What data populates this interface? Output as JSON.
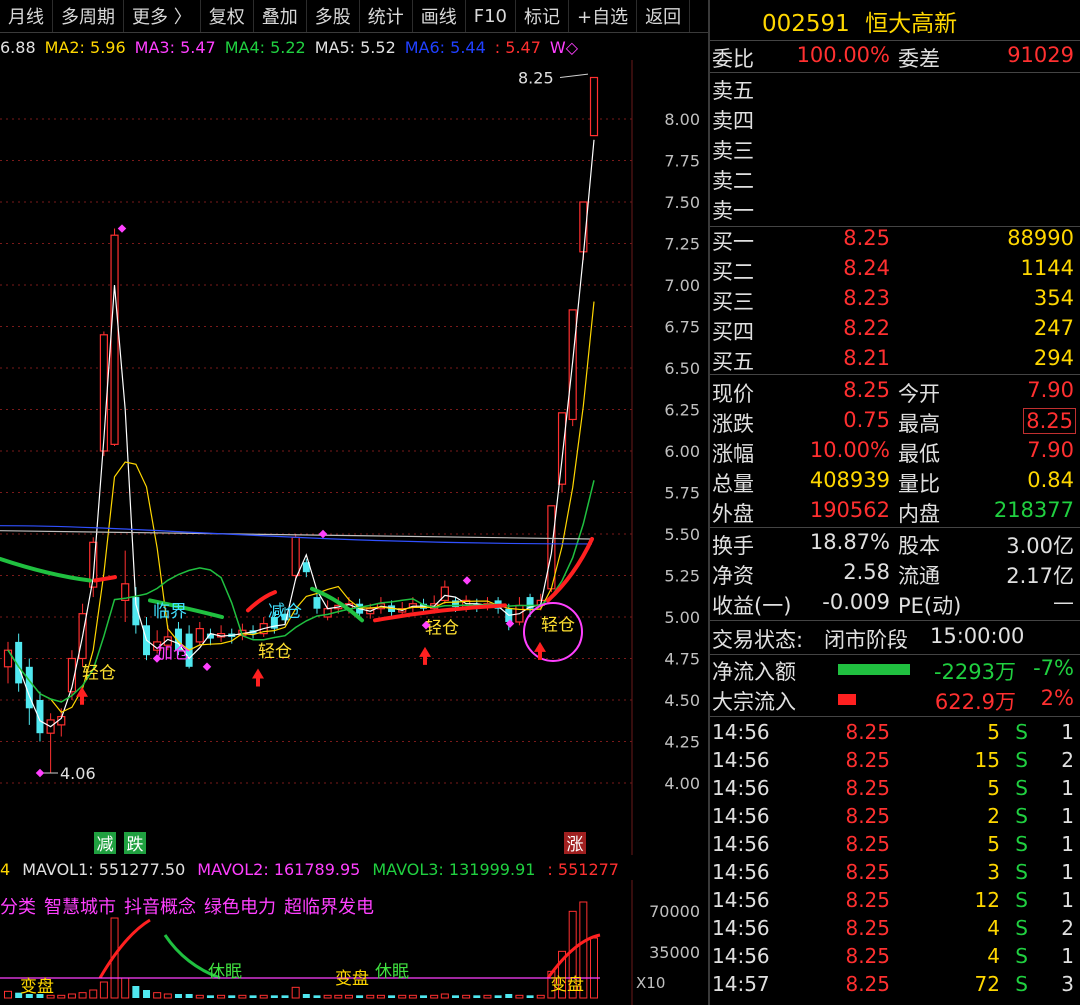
{
  "toolbar": {
    "items": [
      "月线",
      "多周期",
      "更多 〉",
      "复权",
      "叠加",
      "多股",
      "统计",
      "画线",
      "F10",
      "标记",
      "+自选",
      "返回"
    ]
  },
  "ma_legend": {
    "ma1": "6.88",
    "ma2_label": "MA2: 5.96",
    "ma3_label": "MA3: 5.47",
    "ma4_label": "MA4: 5.22",
    "ma5_label": "MA5: 5.52",
    "ma6_label": "MA6: 5.44",
    "ma7_label": ": 5.47",
    "extra": "W◇"
  },
  "price_axis": [
    "8.00",
    "7.75",
    "7.50",
    "7.25",
    "7.00",
    "6.75",
    "6.50",
    "6.25",
    "6.00",
    "5.75",
    "5.50",
    "5.25",
    "5.00",
    "4.75",
    "4.50",
    "4.25",
    "4.00"
  ],
  "annotations": {
    "high_label": "8.25",
    "low_label": "4.06",
    "signal_light": "轻仓",
    "signal_add": "加仓",
    "signal_linjie": "临界",
    "signal_jian": "减仓",
    "signal_reduce": "减",
    "signal_fall": "跌",
    "signal_rise": "涨"
  },
  "vol_legend": {
    "v0": "4",
    "mavol1": "MAVOL1: 551277.50",
    "mavol2": "MAVOL2: 161789.95",
    "mavol3": "MAVOL3: 131999.91",
    "mavol4": ": 551277"
  },
  "concepts": [
    "分类",
    "智慧城市",
    "抖音概念",
    "绿色电力",
    "超临界发电"
  ],
  "vol_axis": [
    "70000",
    "35000"
  ],
  "vol_scale": "X10",
  "vol_marks": {
    "sleep": "休眠",
    "change": "变盘"
  },
  "stock": {
    "code": "002591",
    "name": "恒大高新"
  },
  "weibi": {
    "label1": "委比",
    "value1": "100.00%",
    "label2": "委差",
    "value2": "91029"
  },
  "sell": [
    {
      "label": "卖五"
    },
    {
      "label": "卖四"
    },
    {
      "label": "卖三"
    },
    {
      "label": "卖二"
    },
    {
      "label": "卖一"
    }
  ],
  "buy": [
    {
      "label": "买一",
      "price": "8.25",
      "vol": "88990"
    },
    {
      "label": "买二",
      "price": "8.24",
      "vol": "1144"
    },
    {
      "label": "买三",
      "price": "8.23",
      "vol": "354"
    },
    {
      "label": "买四",
      "price": "8.22",
      "vol": "247"
    },
    {
      "label": "买五",
      "price": "8.21",
      "vol": "294"
    }
  ],
  "quote": [
    {
      "l1": "现价",
      "v1": "8.25",
      "l2": "今开",
      "v2": "7.90"
    },
    {
      "l1": "涨跌",
      "v1": "0.75",
      "l2": "最高",
      "v2": "8.25"
    },
    {
      "l1": "涨幅",
      "v1": "10.00%",
      "l2": "最低",
      "v2": "7.90"
    },
    {
      "l1": "总量",
      "v1": "408939",
      "l2": "量比",
      "v2": "0.84"
    },
    {
      "l1": "外盘",
      "v1": "190562",
      "l2": "内盘",
      "v2": "218377"
    }
  ],
  "fund": [
    {
      "l1": "换手",
      "v1": "18.87%",
      "l2": "股本",
      "v2": "3.00亿"
    },
    {
      "l1": "净资",
      "v1": "2.58",
      "l2": "流通",
      "v2": "2.17亿"
    },
    {
      "l1": "收益(一)",
      "v1": "-0.009",
      "l2": "PE(动)",
      "v2": "—"
    }
  ],
  "status": {
    "label": "交易状态:",
    "value": "闭市阶段",
    "time": "15:00:00"
  },
  "flow": [
    {
      "label": "净流入额",
      "value": "-2293万",
      "pct": "-7%"
    },
    {
      "label": "大宗流入",
      "value": "622.9万",
      "pct": "2%"
    }
  ],
  "ticks": [
    {
      "time": "14:56",
      "price": "8.25",
      "vol": "5",
      "side": "S",
      "n": "1"
    },
    {
      "time": "14:56",
      "price": "8.25",
      "vol": "15",
      "side": "S",
      "n": "2"
    },
    {
      "time": "14:56",
      "price": "8.25",
      "vol": "5",
      "side": "S",
      "n": "1"
    },
    {
      "time": "14:56",
      "price": "8.25",
      "vol": "2",
      "side": "S",
      "n": "1"
    },
    {
      "time": "14:56",
      "price": "8.25",
      "vol": "5",
      "side": "S",
      "n": "1"
    },
    {
      "time": "14:56",
      "price": "8.25",
      "vol": "3",
      "side": "S",
      "n": "1"
    },
    {
      "time": "14:56",
      "price": "8.25",
      "vol": "12",
      "side": "S",
      "n": "1"
    },
    {
      "time": "14:56",
      "price": "8.25",
      "vol": "4",
      "side": "S",
      "n": "2"
    },
    {
      "time": "14:56",
      "price": "8.25",
      "vol": "4",
      "side": "S",
      "n": "1"
    },
    {
      "time": "14:57",
      "price": "8.25",
      "vol": "72",
      "side": "S",
      "n": "3"
    }
  ],
  "candles": [
    {
      "o": 4.7,
      "c": 4.8,
      "h": 4.85,
      "l": 4.6
    },
    {
      "o": 4.85,
      "c": 4.6,
      "h": 4.9,
      "l": 4.55
    },
    {
      "o": 4.7,
      "c": 4.45,
      "h": 4.75,
      "l": 4.35
    },
    {
      "o": 4.5,
      "c": 4.3,
      "h": 4.55,
      "l": 4.25
    },
    {
      "o": 4.3,
      "c": 4.38,
      "h": 4.42,
      "l": 4.06
    },
    {
      "o": 4.35,
      "c": 4.4,
      "h": 4.45,
      "l": 4.28
    },
    {
      "o": 4.55,
      "c": 4.75,
      "h": 4.8,
      "l": 4.5
    },
    {
      "o": 4.75,
      "c": 5.02,
      "h": 5.08,
      "l": 4.7
    },
    {
      "o": 5.18,
      "c": 5.45,
      "h": 5.48,
      "l": 5.12
    },
    {
      "o": 6.0,
      "c": 6.7,
      "h": 6.72,
      "l": 5.97
    },
    {
      "o": 6.04,
      "c": 7.3,
      "h": 7.34,
      "l": 6.03
    },
    {
      "o": 5.1,
      "c": 5.2,
      "h": 5.4,
      "l": 4.97
    },
    {
      "o": 5.12,
      "c": 4.95,
      "h": 5.18,
      "l": 4.9
    },
    {
      "o": 4.95,
      "c": 4.77,
      "h": 5.0,
      "l": 4.74
    },
    {
      "o": 4.8,
      "c": 4.85,
      "h": 4.92,
      "l": 4.78
    },
    {
      "o": 4.83,
      "c": 4.88,
      "h": 4.95,
      "l": 4.8
    },
    {
      "o": 4.93,
      "c": 4.8,
      "h": 4.97,
      "l": 4.77
    },
    {
      "o": 4.9,
      "c": 4.7,
      "h": 4.95,
      "l": 4.69
    },
    {
      "o": 4.85,
      "c": 4.93,
      "h": 4.97,
      "l": 4.83
    },
    {
      "o": 4.9,
      "c": 4.87,
      "h": 4.93,
      "l": 4.83
    },
    {
      "o": 4.88,
      "c": 4.9,
      "h": 4.95,
      "l": 4.85
    },
    {
      "o": 4.9,
      "c": 4.88,
      "h": 4.93,
      "l": 4.84
    },
    {
      "o": 4.89,
      "c": 4.92,
      "h": 4.96,
      "l": 4.86
    },
    {
      "o": 4.92,
      "c": 4.9,
      "h": 4.95,
      "l": 4.87
    },
    {
      "o": 4.9,
      "c": 4.96,
      "h": 5.0,
      "l": 4.88
    },
    {
      "o": 5.0,
      "c": 4.93,
      "h": 5.03,
      "l": 4.9
    },
    {
      "o": 5.02,
      "c": 4.98,
      "h": 5.06,
      "l": 4.95
    },
    {
      "o": 5.25,
      "c": 5.48,
      "h": 5.5,
      "l": 5.22
    },
    {
      "o": 5.33,
      "c": 5.27,
      "h": 5.35,
      "l": 5.24
    },
    {
      "o": 5.12,
      "c": 5.05,
      "h": 5.15,
      "l": 5.02
    },
    {
      "o": 5.0,
      "c": 5.05,
      "h": 5.1,
      "l": 4.98
    },
    {
      "o": 5.05,
      "c": 5.07,
      "h": 5.12,
      "l": 5.02
    },
    {
      "o": 5.05,
      "c": 5.08,
      "h": 5.12,
      "l": 5.02
    },
    {
      "o": 5.08,
      "c": 5.02,
      "h": 5.11,
      "l": 4.98
    },
    {
      "o": 5.02,
      "c": 5.05,
      "h": 5.08,
      "l": 4.99
    },
    {
      "o": 5.05,
      "c": 5.08,
      "h": 5.12,
      "l": 5.02
    },
    {
      "o": 5.07,
      "c": 5.03,
      "h": 5.1,
      "l": 5.0
    },
    {
      "o": 5.03,
      "c": 5.05,
      "h": 5.09,
      "l": 5.0
    },
    {
      "o": 5.06,
      "c": 5.08,
      "h": 5.12,
      "l": 5.03
    },
    {
      "o": 5.08,
      "c": 5.05,
      "h": 5.11,
      "l": 5.02
    },
    {
      "o": 5.05,
      "c": 5.08,
      "h": 5.13,
      "l": 5.02
    },
    {
      "o": 5.1,
      "c": 5.18,
      "h": 5.22,
      "l": 5.08
    },
    {
      "o": 5.1,
      "c": 5.06,
      "h": 5.12,
      "l": 5.03
    },
    {
      "o": 5.06,
      "c": 5.1,
      "h": 5.13,
      "l": 5.03
    },
    {
      "o": 5.08,
      "c": 5.06,
      "h": 5.11,
      "l": 5.03
    },
    {
      "o": 5.06,
      "c": 5.08,
      "h": 5.12,
      "l": 5.04
    },
    {
      "o": 5.1,
      "c": 5.05,
      "h": 5.12,
      "l": 5.02
    },
    {
      "o": 5.05,
      "c": 4.97,
      "h": 5.08,
      "l": 4.92
    },
    {
      "o": 4.97,
      "c": 5.07,
      "h": 5.12,
      "l": 4.95
    },
    {
      "o": 5.12,
      "c": 5.05,
      "h": 5.14,
      "l": 5.0
    },
    {
      "o": 5.07,
      "c": 5.1,
      "h": 5.14,
      "l": 5.04
    },
    {
      "o": 5.17,
      "c": 5.67,
      "h": 5.67,
      "l": 5.15
    },
    {
      "o": 5.8,
      "c": 6.23,
      "h": 6.23,
      "l": 5.75
    },
    {
      "o": 6.19,
      "c": 6.85,
      "h": 6.85,
      "l": 6.15
    },
    {
      "o": 7.2,
      "c": 7.5,
      "h": 7.5,
      "l": 7.15
    },
    {
      "o": 7.9,
      "c": 8.25,
      "h": 8.25,
      "l": 7.9
    }
  ],
  "volumes": [
    5,
    4,
    3,
    3,
    2,
    2,
    3,
    4,
    6,
    12,
    60,
    15,
    9,
    6,
    4,
    3,
    3,
    3,
    2,
    2,
    2,
    2,
    2,
    2,
    2,
    2,
    2,
    8,
    3,
    2,
    2,
    2,
    2,
    2,
    2,
    2,
    2,
    2,
    2,
    2,
    2,
    3,
    2,
    2,
    2,
    2,
    2,
    3,
    2,
    2,
    2,
    20,
    35,
    65,
    72,
    45
  ]
}
